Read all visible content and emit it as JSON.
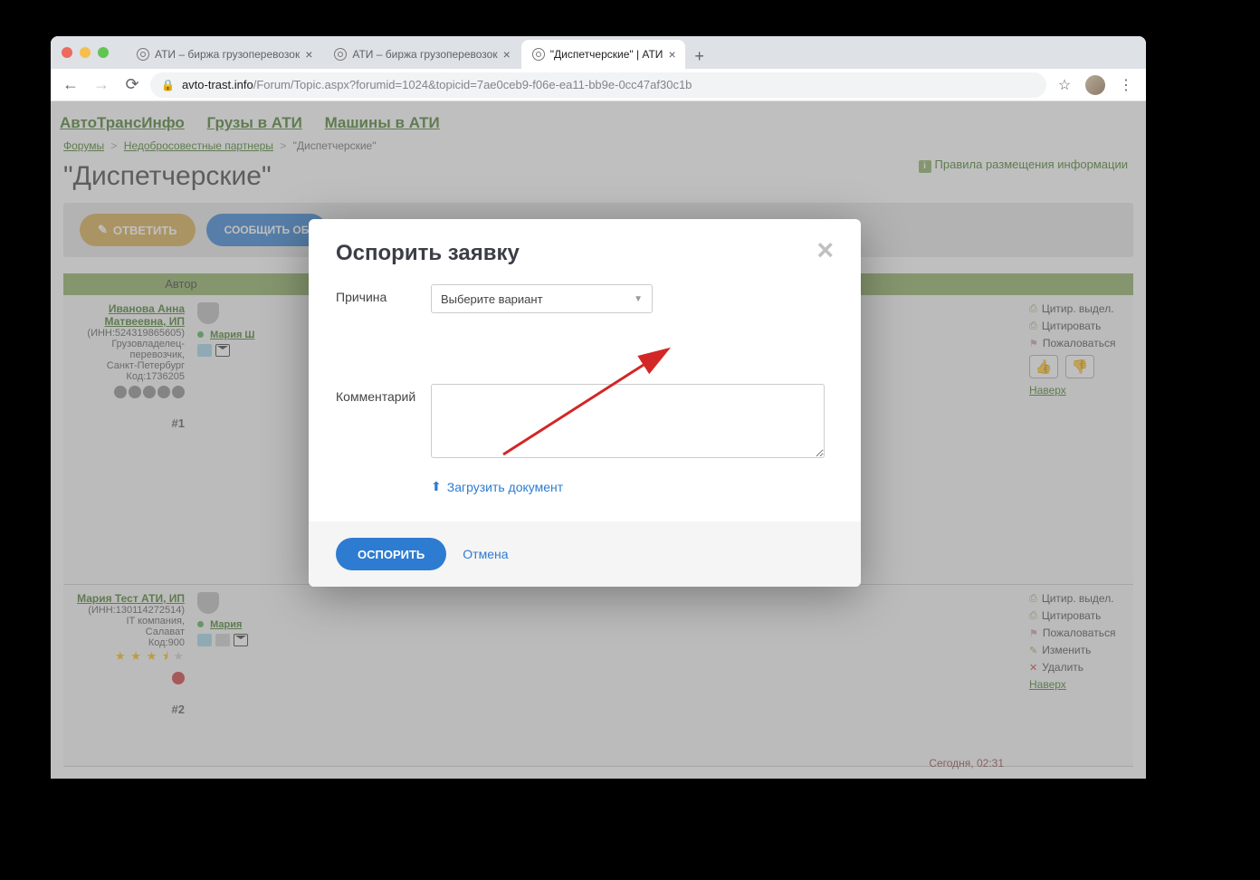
{
  "browser": {
    "tabs": [
      {
        "title": "АТИ – биржа грузоперевозок",
        "active": false
      },
      {
        "title": "АТИ – биржа грузоперевозок",
        "active": false
      },
      {
        "title": "\"Диспетчерские\" | АТИ",
        "active": true
      }
    ],
    "url_host": "avto-trast.info",
    "url_path": "/Forum/Topic.aspx?forumid=1024&topicid=7ae0ceb9-f06e-ea11-bb9e-0cc47af30c1b"
  },
  "top_nav": {
    "link1": "АвтоТрансИнфо",
    "link2": "Грузы в АТИ",
    "link3": "Машины в АТИ"
  },
  "breadcrumb": {
    "forums": "Форумы",
    "section": "Недобросовестные партнеры",
    "topic": "\"Диспетчерские\""
  },
  "rules_link": "Правила размещения информации",
  "page_title": "\"Диспетчерские\"",
  "action_bar": {
    "reply": "ОТВЕТИТЬ",
    "report": "СООБЩИТЬ ОБ"
  },
  "table_header_author": "Автор",
  "posts": [
    {
      "author_name": "Иванова Анна Матвеевна, ИП",
      "inn": "(ИНН:524319865605)",
      "role": "Грузовладелец-перевозчик,",
      "city": "Санкт-Петербург",
      "code": "Код:1736205",
      "num": "#1",
      "user_name": "Мария Ш",
      "time": "Сегодня, 02:31"
    },
    {
      "author_name": "Мария Тест АТИ, ИП",
      "inn": "(ИНН:130114272514)",
      "role": "IT компания,",
      "city": "Салават",
      "code": "Код:900",
      "num": "#2",
      "user_name": "Мария"
    }
  ],
  "post_actions": {
    "quote_sel": "Цитир. выдел.",
    "quote": "Цитировать",
    "complain": "Пожаловаться",
    "edit": "Изменить",
    "delete": "Удалить",
    "back_top": "Наверх"
  },
  "modal": {
    "title": "Оспорить заявку",
    "reason_label": "Причина",
    "reason_placeholder": "Выберите вариант",
    "comment_label": "Комментарий",
    "upload": "Загрузить документ",
    "submit": "ОСПОРИТЬ",
    "cancel": "Отмена"
  }
}
